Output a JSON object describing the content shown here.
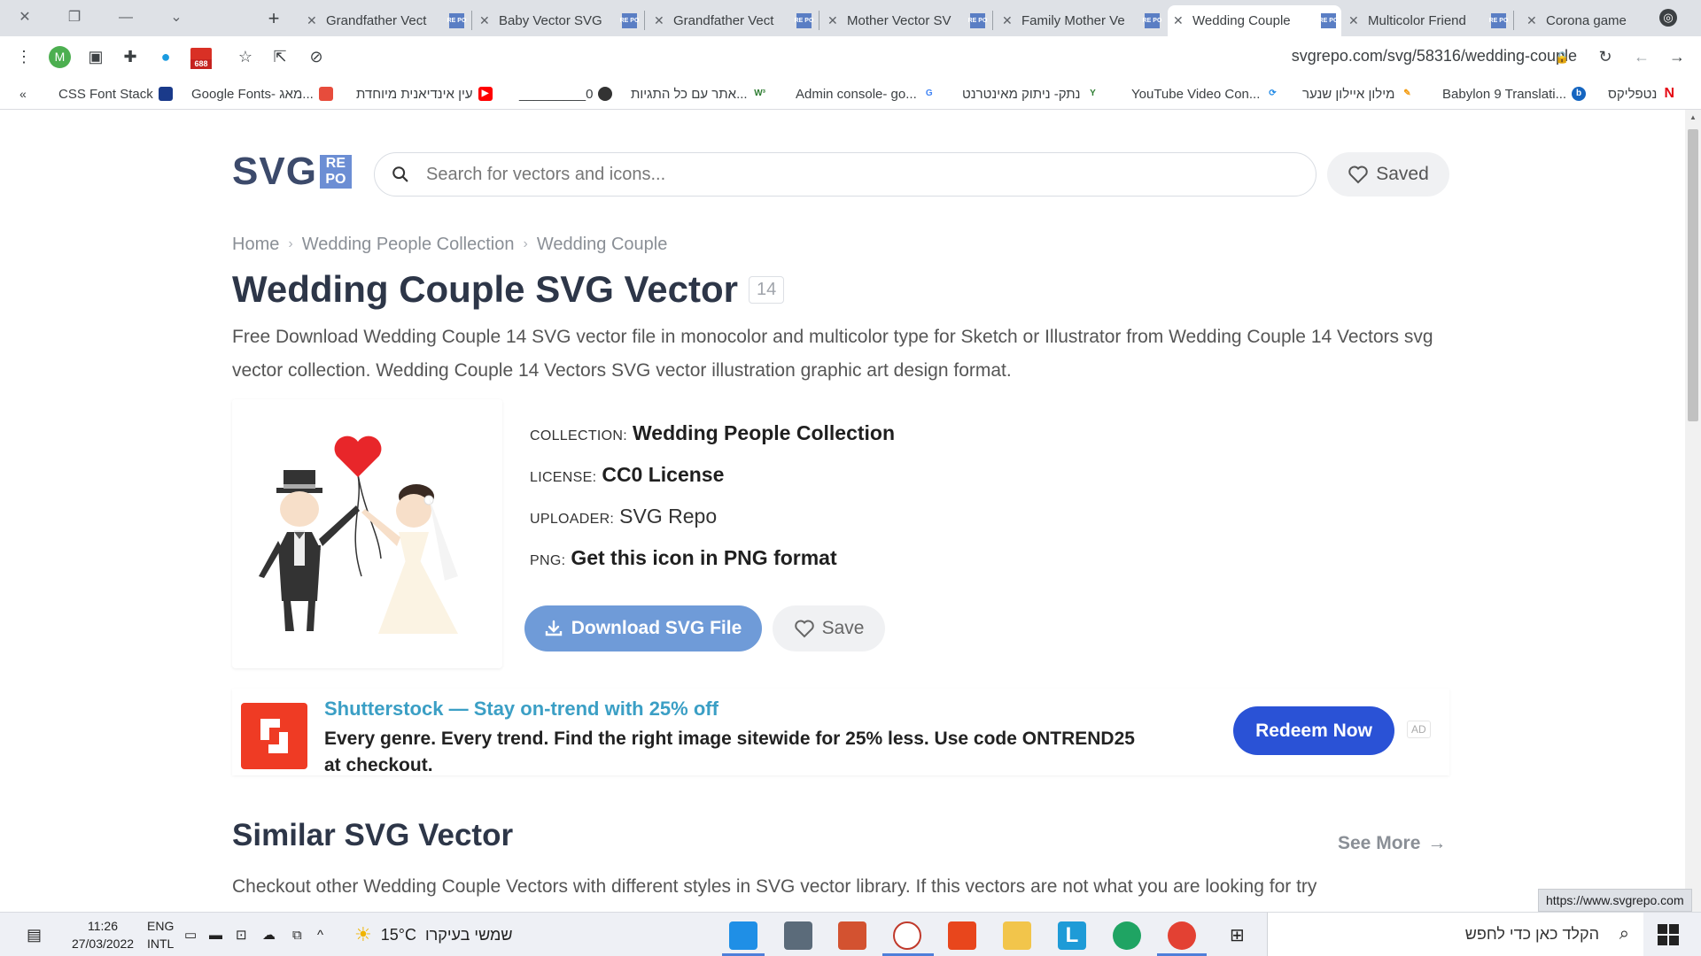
{
  "browser": {
    "tabs": [
      {
        "title": "Grandfather Vect",
        "active": false
      },
      {
        "title": "Baby Vector SVG",
        "active": false
      },
      {
        "title": "Grandfather Vect",
        "active": false
      },
      {
        "title": "Mother Vector SV",
        "active": false
      },
      {
        "title": "Family Mother Ve",
        "active": false
      },
      {
        "title": "Wedding Couple",
        "active": true
      },
      {
        "title": "Multicolor Friend",
        "active": false
      },
      {
        "title": "Corona game",
        "active": false
      }
    ],
    "favicon_text": "RE PO",
    "new_tab": "+",
    "url": "svgrepo.com/svg/58316/wedding-couple",
    "profile_initial": "M",
    "gmail_count": "688",
    "bookmarks_toggle": "«",
    "bookmarks": [
      "CSS Font Stack",
      "Google Fonts- מאג...",
      "עין אינדיאנית מיוחדת",
      "_________0",
      "אתר עם כל התגיות...",
      "Admin console- go...",
      "נתק- ניתוק מאינטרנט",
      "YouTube Video Con...",
      "מילון איילון שנער",
      "Babylon 9 Translati...",
      "נטפליקס"
    ]
  },
  "site": {
    "logo_text": "SVG",
    "logo_badge": "RE PO",
    "search_placeholder": "Search for vectors and icons...",
    "saved_label": "Saved"
  },
  "breadcrumb": [
    "Home",
    "Wedding People Collection",
    "Wedding Couple"
  ],
  "page": {
    "title": "Wedding Couple SVG Vector",
    "title_count": "14",
    "description": "Free Download Wedding Couple 14 SVG vector file in monocolor and multicolor type for Sketch or Illustrator from Wedding Couple 14 Vectors svg vector collection. Wedding Couple 14 Vectors SVG vector illustration graphic art design format.",
    "meta": {
      "collection_label": "COLLECTION:",
      "collection_value": "Wedding People Collection",
      "license_label": "LICENSE:",
      "license_value": "CC0 License",
      "uploader_label": "UPLOADER:",
      "uploader_value": "SVG Repo",
      "png_label": "PNG:",
      "png_value": "Get this icon in PNG format"
    },
    "download_label": "Download SVG File",
    "save_label": "Save"
  },
  "ad": {
    "headline": "Shutterstock — Stay on-trend with 25% off",
    "body": "Every genre. Every trend. Find the right image sitewide for 25% less. Use code ONTREND25 at checkout.",
    "cta": "Redeem Now",
    "tag": "AD"
  },
  "similar": {
    "title": "Similar SVG Vector",
    "see_more": "See More",
    "description": "Checkout other Wedding Couple Vectors with different styles in SVG vector library. If this vectors are not what you are looking for try"
  },
  "status_url": "https://www.svgrepo.com",
  "taskbar": {
    "time": "11:26",
    "date": "27/03/2022",
    "lang_top": "ENG",
    "lang_bottom": "INTL",
    "weather_temp": "15°C",
    "weather_text": "שמשי בעיקרו",
    "search_text": "הקלד כאן כדי לחפש"
  },
  "colors": {
    "accent": "#6f9bd8",
    "ad_headline": "#3b9fc5",
    "redeem": "#2a52d6",
    "title": "#2d3648"
  }
}
